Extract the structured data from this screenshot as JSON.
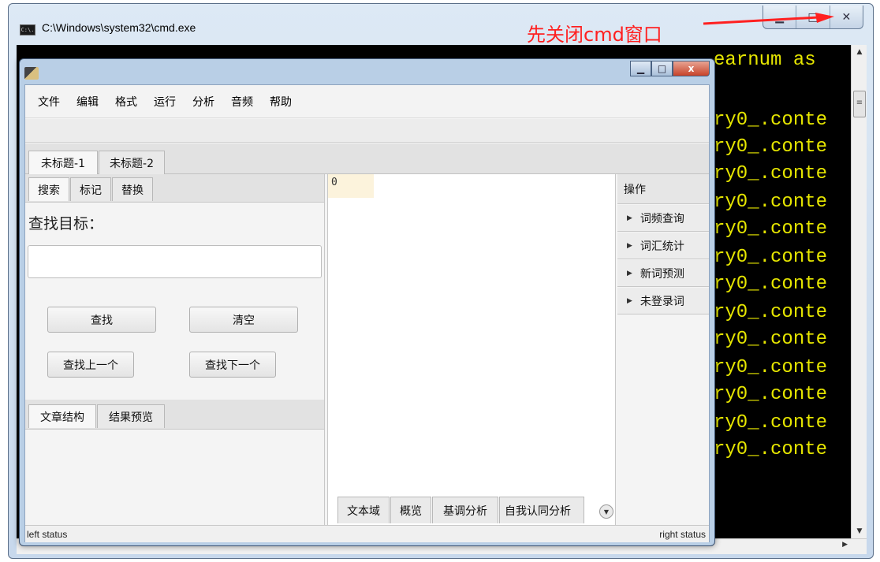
{
  "cmd_window": {
    "title": "C:\\Windows\\system32\\cmd.exe",
    "icon_text": "C:\\.",
    "top_line": "Hibernate: select ... yearnum as",
    "top_line_visible": "earnum as",
    "console_lines": [
      "ry0_.conte",
      "ry0_.conte",
      "ry0_.conte",
      "ry0_.conte",
      "ry0_.conte",
      "ry0_.conte",
      "ry0_.conte",
      "ry0_.conte",
      "ry0_.conte",
      "ry0_.conte",
      "ry0_.conte",
      "ry0_.conte",
      "ry0_.conte"
    ],
    "minimize_glyph": "▁",
    "maximize_glyph": "□",
    "close_glyph": "✕"
  },
  "annotation": {
    "text": "先关闭cmd窗口",
    "color": "#ff2020"
  },
  "app_window": {
    "close_glyph": "x",
    "menu": [
      "文件",
      "编辑",
      "格式",
      "运行",
      "分析",
      "音频",
      "帮助"
    ],
    "doc_tabs": [
      "未标题-1",
      "未标题-2"
    ],
    "left": {
      "subtabs": [
        "搜索",
        "标记",
        "替换"
      ],
      "find_label": "查找目标：",
      "find_value": "",
      "buttons": {
        "find": "查找",
        "clear": "清空",
        "prev": "查找上一个",
        "next": "查找下一个"
      },
      "bottom_tabs": [
        "文章结构",
        "结果预览"
      ]
    },
    "center": {
      "line_number": "0",
      "tabs": [
        "文本域",
        "概览",
        "基调分析",
        "自我认同分析"
      ]
    },
    "right": {
      "header": "操作",
      "items": [
        "词频查询",
        "词汇统计",
        "新词预测",
        "未登录词"
      ]
    },
    "status": {
      "left": "left status",
      "right": "right status"
    }
  }
}
